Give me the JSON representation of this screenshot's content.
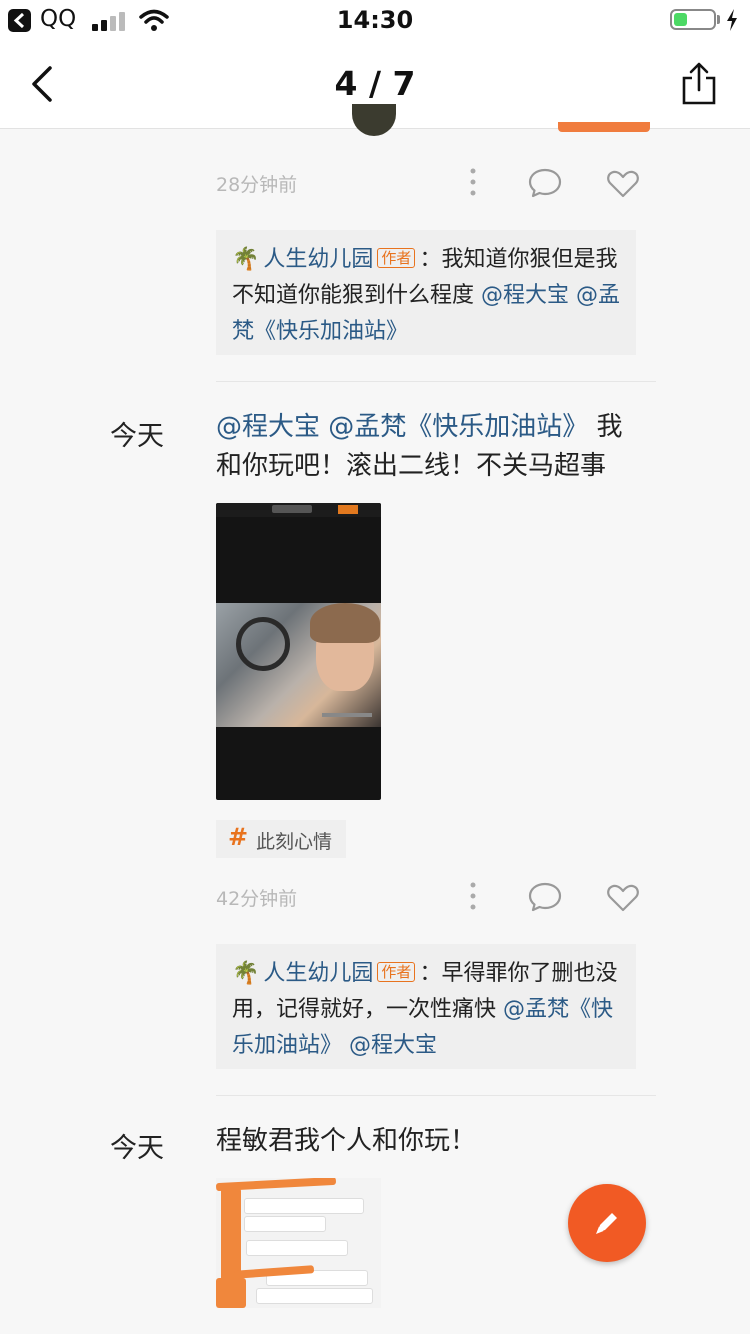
{
  "status_bar": {
    "app_name": "QQ",
    "time": "14:30",
    "battery_level": 0.35,
    "colors": {
      "battery": "#4cd964"
    }
  },
  "nav": {
    "title": "4 / 7",
    "back_icon": "chevron-left-icon",
    "share_icon": "share-icon"
  },
  "thread1": {
    "time_ago": "28分钟前",
    "reply": {
      "user": "人生幼儿园",
      "badge": "作者",
      "colon": "：",
      "text": "我知道你狠但是我不知道你能狠到什么程度 ",
      "mention1": "@程大宝",
      "mention2": "@孟梵《快乐加油站》"
    }
  },
  "post1": {
    "day": "今天",
    "mention1": "@程大宝",
    "mention2": "@孟梵《快乐加油站》",
    "text": " 我和你玩吧！滚出二线！不关马超事",
    "tag": "此刻心情",
    "time_ago": "42分钟前",
    "reply": {
      "user": "人生幼儿园",
      "badge": "作者",
      "colon": "：",
      "text": "早得罪你了删也没用，记得就好，一次性痛快 ",
      "mention1": "@孟梵《快乐加油站》",
      "mention2": "@程大宝"
    }
  },
  "post2": {
    "day": "今天",
    "text": "程敏君我个人和你玩！"
  },
  "fab": {
    "icon": "pencil-icon",
    "color": "#f15a24"
  },
  "colors": {
    "accent": "#e8731e",
    "link": "#2b5a86"
  }
}
